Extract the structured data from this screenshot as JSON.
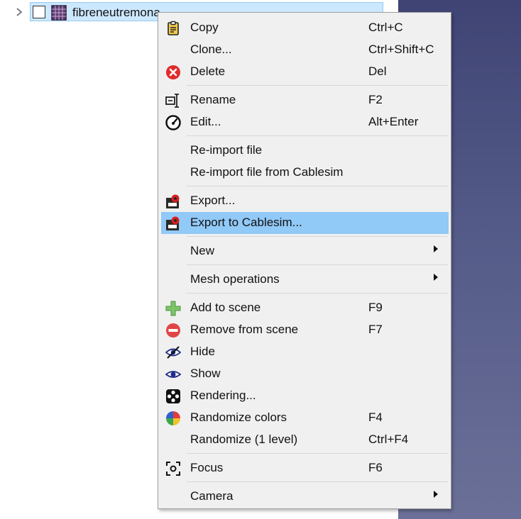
{
  "tree": {
    "item_label": "fibreneutremona",
    "icons": {
      "expander": "chevron-right-icon",
      "checkbox": "checkbox-unchecked",
      "mesh": "mesh-grid-icon"
    }
  },
  "menu": {
    "highlighted_index": 8,
    "items": [
      {
        "label": "Copy",
        "shortcut": "Ctrl+C",
        "icon": "copy-icon"
      },
      {
        "label": "Clone...",
        "shortcut": "Ctrl+Shift+C",
        "icon": ""
      },
      {
        "label": "Delete",
        "shortcut": "Del",
        "icon": "delete-icon"
      },
      {
        "label": "Rename",
        "shortcut": "F2",
        "icon": "rename-icon"
      },
      {
        "label": "Edit...",
        "shortcut": "Alt+Enter",
        "icon": "edit-gauge-icon"
      },
      {
        "label": "Re-import file",
        "shortcut": "",
        "icon": ""
      },
      {
        "label": "Re-import file from Cablesim",
        "shortcut": "",
        "icon": ""
      },
      {
        "label": "Export...",
        "shortcut": "",
        "icon": "export-icon"
      },
      {
        "label": "Export to Cablesim...",
        "shortcut": "",
        "icon": "export-icon"
      },
      {
        "label": "New",
        "shortcut": "",
        "icon": "",
        "submenu": true
      },
      {
        "label": "Mesh operations",
        "shortcut": "",
        "icon": "",
        "submenu": true
      },
      {
        "label": "Add to scene",
        "shortcut": "F9",
        "icon": "add-icon"
      },
      {
        "label": "Remove from scene",
        "shortcut": "F7",
        "icon": "remove-icon"
      },
      {
        "label": "Hide",
        "shortcut": "",
        "icon": "hide-eye-icon"
      },
      {
        "label": "Show",
        "shortcut": "",
        "icon": "show-eye-icon"
      },
      {
        "label": "Rendering...",
        "shortcut": "",
        "icon": "rendering-icon"
      },
      {
        "label": "Randomize colors",
        "shortcut": "F4",
        "icon": "randomize-colors-icon"
      },
      {
        "label": "Randomize (1 level)",
        "shortcut": "Ctrl+F4",
        "icon": ""
      },
      {
        "label": "Focus",
        "shortcut": "F6",
        "icon": "focus-icon"
      },
      {
        "label": "Camera",
        "shortcut": "",
        "icon": "",
        "submenu": true
      }
    ]
  },
  "colors": {
    "highlight": "#91c9f7",
    "tree_selection": "#cce8ff",
    "viewport_top": "#3f4474",
    "viewport_bottom": "#6b7098"
  }
}
